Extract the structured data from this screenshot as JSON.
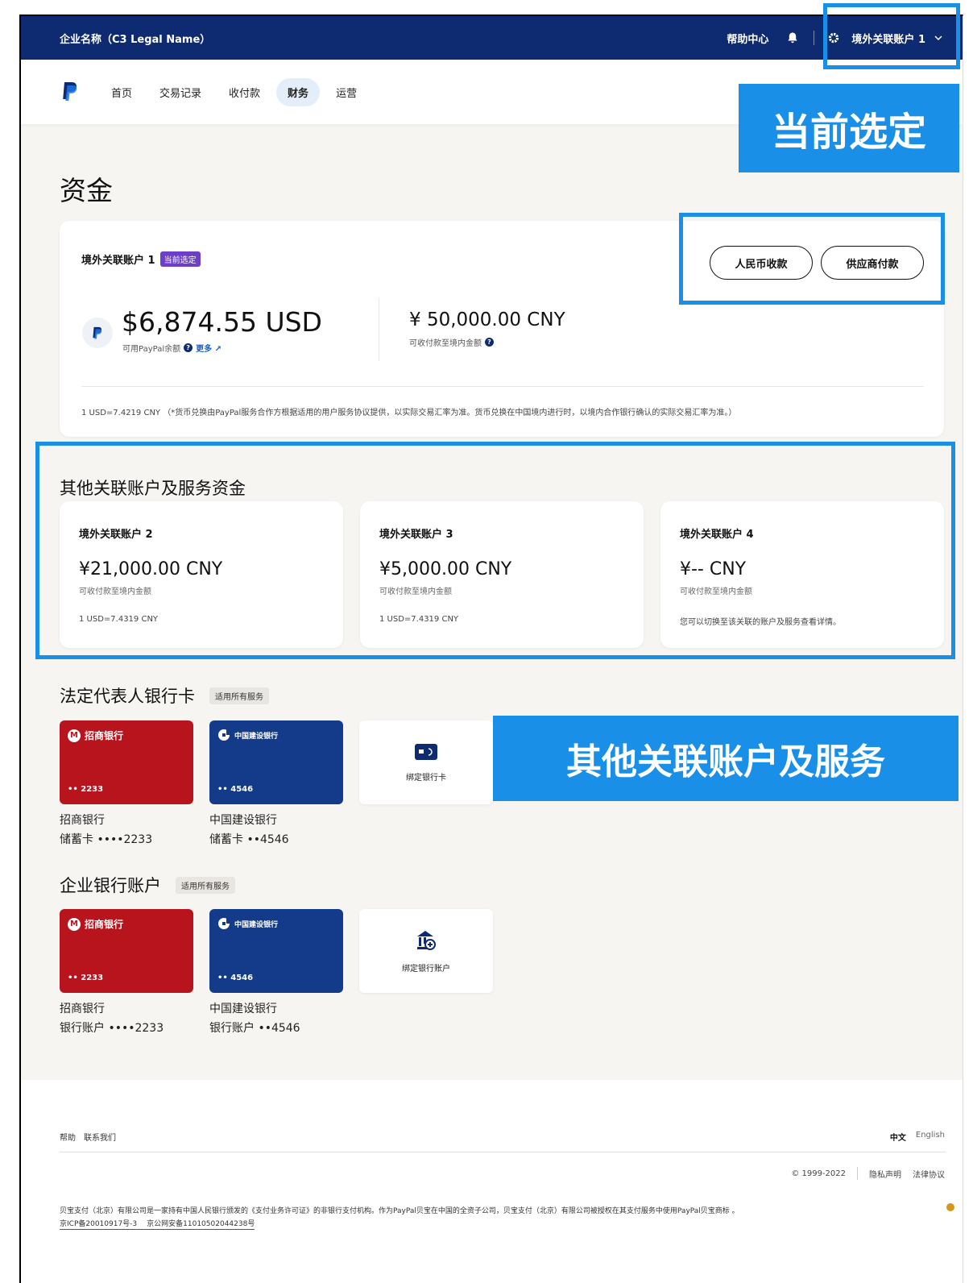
{
  "topbar": {
    "company": "企业名称（C3 Legal Name）",
    "help": "帮助中心",
    "account": "境外关联账户 1"
  },
  "nav": {
    "items": [
      "首页",
      "交易记录",
      "收付款",
      "财务",
      "运营"
    ],
    "active": "财务"
  },
  "page": {
    "title": "资金"
  },
  "main_account": {
    "name": "境外关联账户 1",
    "badge": "当前选定",
    "btn_rmb": "人民币收款",
    "btn_supplier": "供应商付款",
    "usd_amount": "$6,874.55 USD",
    "usd_label": "可用PayPal余额",
    "more": "更多",
    "cny_amount": "¥ 50,000.00 CNY",
    "cny_label": "可收付款至境内金额",
    "rate_note": "1 USD=7.4219 CNY （*货币兑换由PayPal服务合作方根据适用的用户服务协议提供，以实际交易汇率为准。货币兑换在中国境内进行时，以境内合作银行确认的实际交易汇率为准。）"
  },
  "other_section": {
    "title": "其他关联账户及服务资金",
    "accounts": [
      {
        "name": "境外关联账户 2",
        "amount": "¥21,000.00 CNY",
        "label": "可收付款至境内金额",
        "foot": "1 USD=7.4319 CNY"
      },
      {
        "name": "境外关联账户 3",
        "amount": "¥5,000.00 CNY",
        "label": "可收付款至境内金额",
        "foot": "1 USD=7.4319 CNY"
      },
      {
        "name": "境外关联账户 4",
        "amount": "¥-- CNY",
        "label": "可收付款至境内金额",
        "foot": "您可以切换至该关联的账户及服务查看详情。"
      }
    ]
  },
  "legal_rep": {
    "title": "法定代表人银行卡",
    "tag": "适用所有服务",
    "cards": [
      {
        "bank_logo": "招商银行",
        "num": "•• 2233",
        "bank": "招商银行",
        "detail": "储蓄卡 ••••2233",
        "color": "#b8141e"
      },
      {
        "bank_logo": "中国建设银行",
        "num": "•• 4546",
        "bank": "中国建设银行",
        "detail": "储蓄卡 ••4546",
        "color": "#133b8a"
      }
    ],
    "bind_label": "绑定银行卡"
  },
  "corporate": {
    "title": "企业银行账户",
    "tag": "适用所有服务",
    "cards": [
      {
        "bank_logo": "招商银行",
        "num": "•• 2233",
        "bank": "招商银行",
        "detail": "银行账户 ••••2233",
        "color": "#b8141e"
      },
      {
        "bank_logo": "中国建设银行",
        "num": "•• 4546",
        "bank": "中国建设银行",
        "detail": "银行账户 ••4546",
        "color": "#133b8a"
      }
    ],
    "bind_label": "绑定银行账户"
  },
  "footer": {
    "help": "帮助",
    "contact": "联系我们",
    "lang_zh": "中文",
    "lang_en": "English",
    "copyright": "© 1999-2022",
    "privacy": "隐私声明",
    "legal": "法律协议",
    "desc": "贝宝支付（北京）有限公司是一家持有中国人民银行颁发的《支付业务许可证》的非银行支付机构。作为PayPal贝宝在中国的全资子公司，贝宝支付（北京）有限公司被授权在其支付服务中使用PayPal贝宝商标 。",
    "icp": "京ICP备20010917号-3",
    "police": "京公网安备11010502044238号"
  },
  "annotations": {
    "current_selected": "当前选定",
    "other_services": "其他关联账户及服务"
  },
  "colors": {
    "topbar": "#0e2a70",
    "highlight": "#1a8fe8",
    "badge": "#6b3fc8"
  }
}
